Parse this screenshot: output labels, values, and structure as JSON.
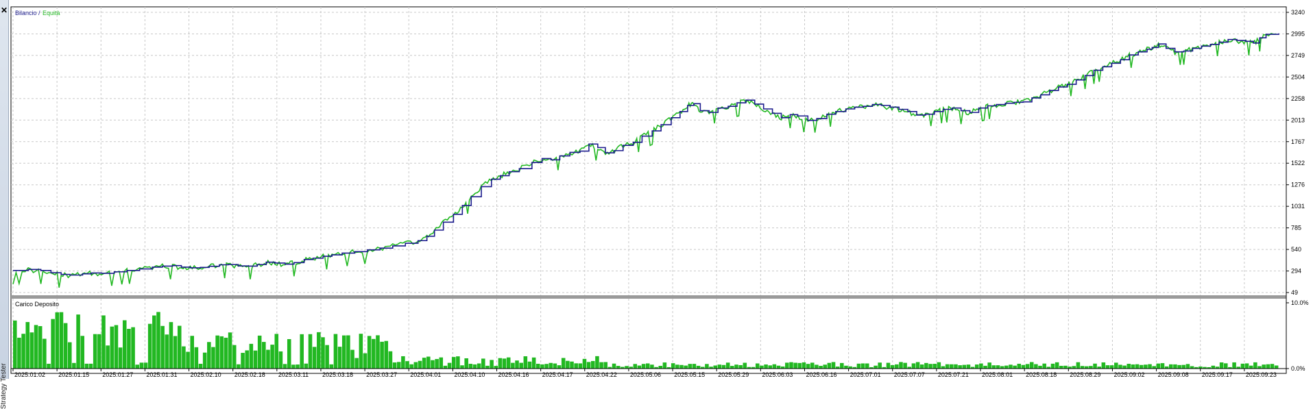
{
  "panel": {
    "title": "Strategy Tester",
    "close_icon": "close-icon"
  },
  "colors": {
    "balance": "#1a1a8c",
    "equity": "#22b822",
    "deposit_bars": "#22b822",
    "grid": "#c8c8c8",
    "frame": "#000000",
    "separator": "#9a9a9a"
  },
  "chart_data": [
    {
      "type": "line",
      "legend": {
        "balance": "Bilancio",
        "separator": " / ",
        "equity": "Equità"
      },
      "y_ticks": [
        "3240",
        "2995",
        "2749",
        "2504",
        "2258",
        "2013",
        "1767",
        "1522",
        "1276",
        "1031",
        "785",
        "540",
        "294",
        "49"
      ],
      "ylim": [
        49,
        3240
      ],
      "x_labels": [
        "2025.01.02",
        "2025.01.15",
        "2025.01.27",
        "2025.01.31",
        "2025.02.10",
        "2025.02.18",
        "2025.03.11",
        "2025.03.18",
        "2025.03.27",
        "2025.04.01",
        "2025.04.10",
        "2025.04.16",
        "2025.04.17",
        "2025.04.22",
        "2025.05.06",
        "2025.05.15",
        "2025.05.29",
        "2025.06.03",
        "2025.06.16",
        "2025.07.01",
        "2025.07.07",
        "2025.07.21",
        "2025.08.01",
        "2025.08.18",
        "2025.08.29",
        "2025.09.02",
        "2025.09.08",
        "2025.09.17",
        "2025.09.23"
      ],
      "grid": true,
      "series": [
        {
          "name": "Bilancio",
          "values": [
            [
              0.0,
              300
            ],
            [
              0.012,
              312
            ],
            [
              0.022,
              300
            ],
            [
              0.03,
              275
            ],
            [
              0.038,
              255
            ],
            [
              0.045,
              248
            ],
            [
              0.055,
              262
            ],
            [
              0.062,
              272
            ],
            [
              0.07,
              268
            ],
            [
              0.08,
              285
            ],
            [
              0.09,
              300
            ],
            [
              0.1,
              318
            ],
            [
              0.11,
              338
            ],
            [
              0.118,
              350
            ],
            [
              0.126,
              356
            ],
            [
              0.133,
              338
            ],
            [
              0.14,
              330
            ],
            [
              0.148,
              335
            ],
            [
              0.155,
              348
            ],
            [
              0.163,
              365
            ],
            [
              0.17,
              368
            ],
            [
              0.178,
              352
            ],
            [
              0.186,
              350
            ],
            [
              0.193,
              368
            ],
            [
              0.2,
              395
            ],
            [
              0.207,
              385
            ],
            [
              0.215,
              372
            ],
            [
              0.222,
              390
            ],
            [
              0.23,
              425
            ],
            [
              0.237,
              440
            ],
            [
              0.245,
              462
            ],
            [
              0.252,
              478
            ],
            [
              0.26,
              498
            ],
            [
              0.27,
              515
            ],
            [
              0.28,
              535
            ],
            [
              0.29,
              555
            ],
            [
              0.3,
              580
            ],
            [
              0.31,
              610
            ],
            [
              0.32,
              640
            ],
            [
              0.327,
              690
            ],
            [
              0.333,
              760
            ],
            [
              0.34,
              850
            ],
            [
              0.348,
              940
            ],
            [
              0.355,
              1040
            ],
            [
              0.362,
              1140
            ],
            [
              0.37,
              1255
            ],
            [
              0.378,
              1340
            ],
            [
              0.385,
              1380
            ],
            [
              0.392,
              1425
            ],
            [
              0.4,
              1460
            ],
            [
              0.41,
              1530
            ],
            [
              0.418,
              1575
            ],
            [
              0.425,
              1560
            ],
            [
              0.432,
              1605
            ],
            [
              0.44,
              1645
            ],
            [
              0.448,
              1660
            ],
            [
              0.455,
              1740
            ],
            [
              0.462,
              1700
            ],
            [
              0.468,
              1640
            ],
            [
              0.475,
              1665
            ],
            [
              0.482,
              1725
            ],
            [
              0.49,
              1760
            ],
            [
              0.497,
              1830
            ],
            [
              0.505,
              1890
            ],
            [
              0.512,
              1960
            ],
            [
              0.52,
              2040
            ],
            [
              0.527,
              2110
            ],
            [
              0.533,
              2180
            ],
            [
              0.538,
              2200
            ],
            [
              0.543,
              2120
            ],
            [
              0.55,
              2100
            ],
            [
              0.557,
              2150
            ],
            [
              0.565,
              2170
            ],
            [
              0.572,
              2210
            ],
            [
              0.579,
              2240
            ],
            [
              0.586,
              2195
            ],
            [
              0.593,
              2140
            ],
            [
              0.6,
              2090
            ],
            [
              0.607,
              2040
            ],
            [
              0.614,
              2075
            ],
            [
              0.62,
              2060
            ],
            [
              0.628,
              2010
            ],
            [
              0.635,
              2030
            ],
            [
              0.643,
              2080
            ],
            [
              0.65,
              2110
            ],
            [
              0.658,
              2140
            ],
            [
              0.665,
              2160
            ],
            [
              0.672,
              2170
            ],
            [
              0.679,
              2190
            ],
            [
              0.686,
              2180
            ],
            [
              0.693,
              2160
            ],
            [
              0.7,
              2135
            ],
            [
              0.707,
              2110
            ],
            [
              0.714,
              2070
            ],
            [
              0.721,
              2080
            ],
            [
              0.728,
              2110
            ],
            [
              0.735,
              2135
            ],
            [
              0.742,
              2150
            ],
            [
              0.749,
              2120
            ],
            [
              0.756,
              2100
            ],
            [
              0.763,
              2150
            ],
            [
              0.77,
              2175
            ],
            [
              0.777,
              2190
            ],
            [
              0.784,
              2205
            ],
            [
              0.791,
              2215
            ],
            [
              0.798,
              2220
            ],
            [
              0.805,
              2265
            ],
            [
              0.812,
              2300
            ],
            [
              0.819,
              2350
            ],
            [
              0.826,
              2390
            ],
            [
              0.833,
              2420
            ],
            [
              0.84,
              2470
            ],
            [
              0.847,
              2520
            ],
            [
              0.854,
              2580
            ],
            [
              0.861,
              2620
            ],
            [
              0.868,
              2660
            ],
            [
              0.875,
              2700
            ],
            [
              0.882,
              2755
            ],
            [
              0.889,
              2790
            ],
            [
              0.896,
              2820
            ],
            [
              0.9,
              2840
            ],
            [
              0.905,
              2880
            ],
            [
              0.911,
              2830
            ],
            [
              0.918,
              2790
            ],
            [
              0.925,
              2800
            ],
            [
              0.932,
              2830
            ],
            [
              0.939,
              2855
            ],
            [
              0.946,
              2875
            ],
            [
              0.953,
              2900
            ],
            [
              0.96,
              2930
            ],
            [
              0.967,
              2920
            ],
            [
              0.974,
              2910
            ],
            [
              0.98,
              2890
            ],
            [
              0.985,
              2950
            ],
            [
              0.99,
              2990
            ],
            [
              1.0,
              3000
            ]
          ]
        },
        {
          "name": "Equità",
          "values": []
        }
      ]
    },
    {
      "type": "bar",
      "title": "Carico Deposito",
      "y_ticks": [
        "10.0%",
        "0.0%"
      ],
      "ylim": [
        0,
        10
      ],
      "unit": "%",
      "bar_count": 300
    }
  ]
}
